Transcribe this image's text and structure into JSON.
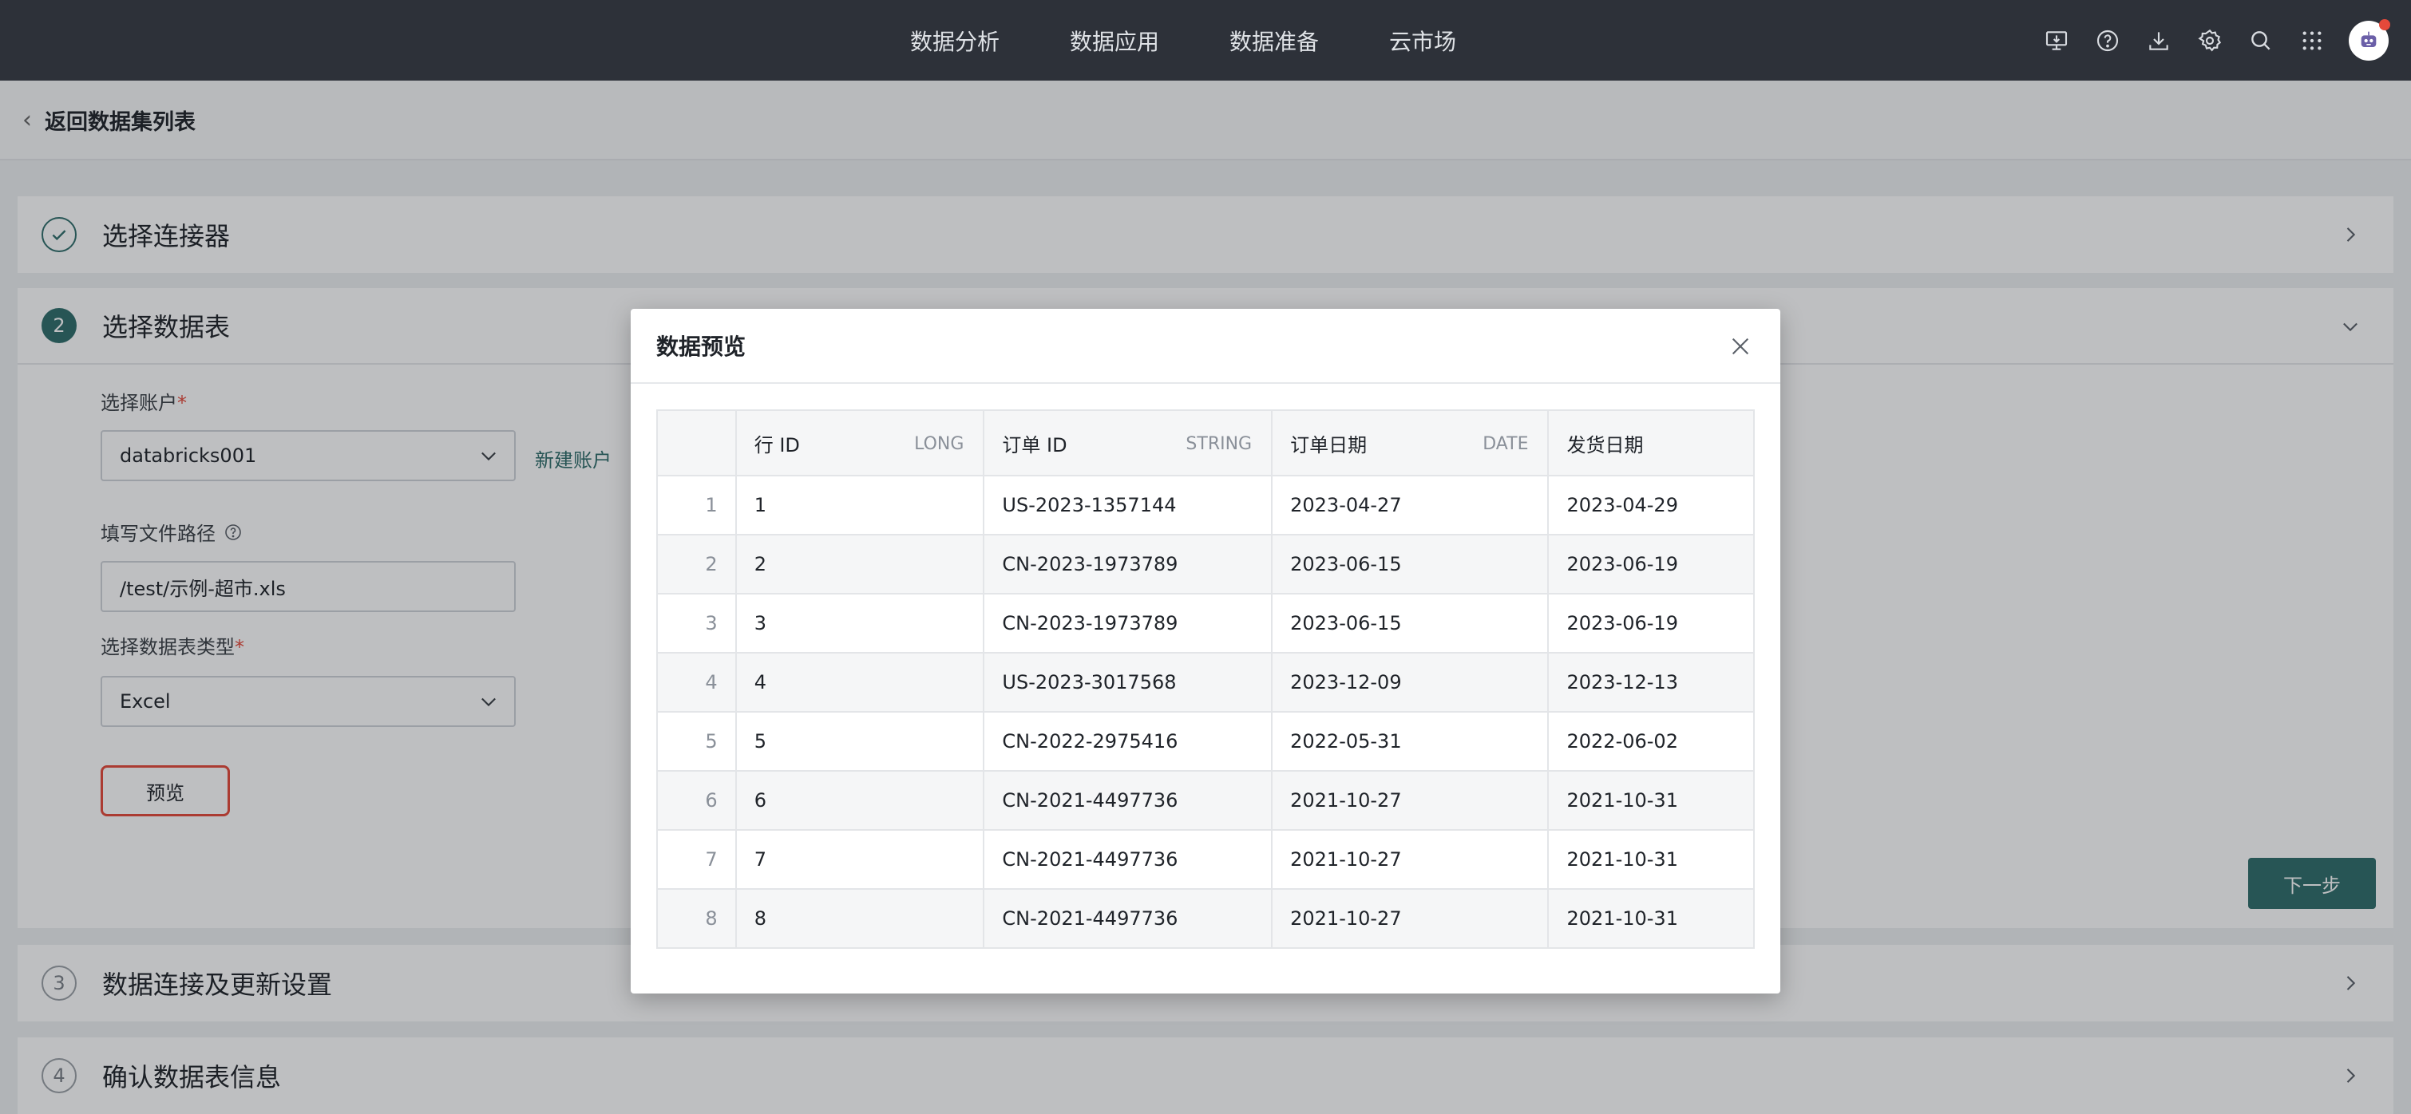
{
  "nav": {
    "items": [
      "数据分析",
      "数据应用",
      "数据准备",
      "云市场"
    ],
    "icons": [
      "monitor-download-icon",
      "help-icon",
      "download-icon",
      "gear-icon",
      "search-icon",
      "apps-grid-icon"
    ]
  },
  "back": {
    "label": "返回数据集列表"
  },
  "steps": {
    "s1": {
      "title": "选择连接器"
    },
    "s2": {
      "num": "2",
      "title": "选择数据表"
    },
    "s3": {
      "num": "3",
      "title": "数据连接及更新设置"
    },
    "s4": {
      "num": "4",
      "title": "确认数据表信息"
    }
  },
  "form": {
    "account_label": "选择账户",
    "account_value": "databricks001",
    "new_account": "新建账户",
    "path_label": "填写文件路径",
    "path_value": "/test/示例-超市.xls",
    "type_label": "选择数据表类型",
    "type_value": "Excel",
    "required_mark": "*",
    "preview_button": "预览",
    "next_button": "下一步"
  },
  "modal": {
    "title": "数据预览",
    "columns": [
      {
        "name": "行 ID",
        "type": "LONG"
      },
      {
        "name": "订单 ID",
        "type": "STRING"
      },
      {
        "name": "订单日期",
        "type": "DATE"
      },
      {
        "name": "发货日期",
        "type": ""
      }
    ],
    "rows": [
      {
        "idx": "1",
        "row_id": "1",
        "order_id": "US-2023-1357144",
        "order_date": "2023-04-27",
        "ship_date": "2023-04-29"
      },
      {
        "idx": "2",
        "row_id": "2",
        "order_id": "CN-2023-1973789",
        "order_date": "2023-06-15",
        "ship_date": "2023-06-19"
      },
      {
        "idx": "3",
        "row_id": "3",
        "order_id": "CN-2023-1973789",
        "order_date": "2023-06-15",
        "ship_date": "2023-06-19"
      },
      {
        "idx": "4",
        "row_id": "4",
        "order_id": "US-2023-3017568",
        "order_date": "2023-12-09",
        "ship_date": "2023-12-13"
      },
      {
        "idx": "5",
        "row_id": "5",
        "order_id": "CN-2022-2975416",
        "order_date": "2022-05-31",
        "ship_date": "2022-06-02"
      },
      {
        "idx": "6",
        "row_id": "6",
        "order_id": "CN-2021-4497736",
        "order_date": "2021-10-27",
        "ship_date": "2021-10-31"
      },
      {
        "idx": "7",
        "row_id": "7",
        "order_id": "CN-2021-4497736",
        "order_date": "2021-10-27",
        "ship_date": "2021-10-31"
      },
      {
        "idx": "8",
        "row_id": "8",
        "order_id": "CN-2021-4497736",
        "order_date": "2021-10-27",
        "ship_date": "2021-10-31"
      }
    ]
  },
  "colors": {
    "accent": "#2f6d6a",
    "topbar": "#2d3139",
    "required": "#e5493a"
  }
}
